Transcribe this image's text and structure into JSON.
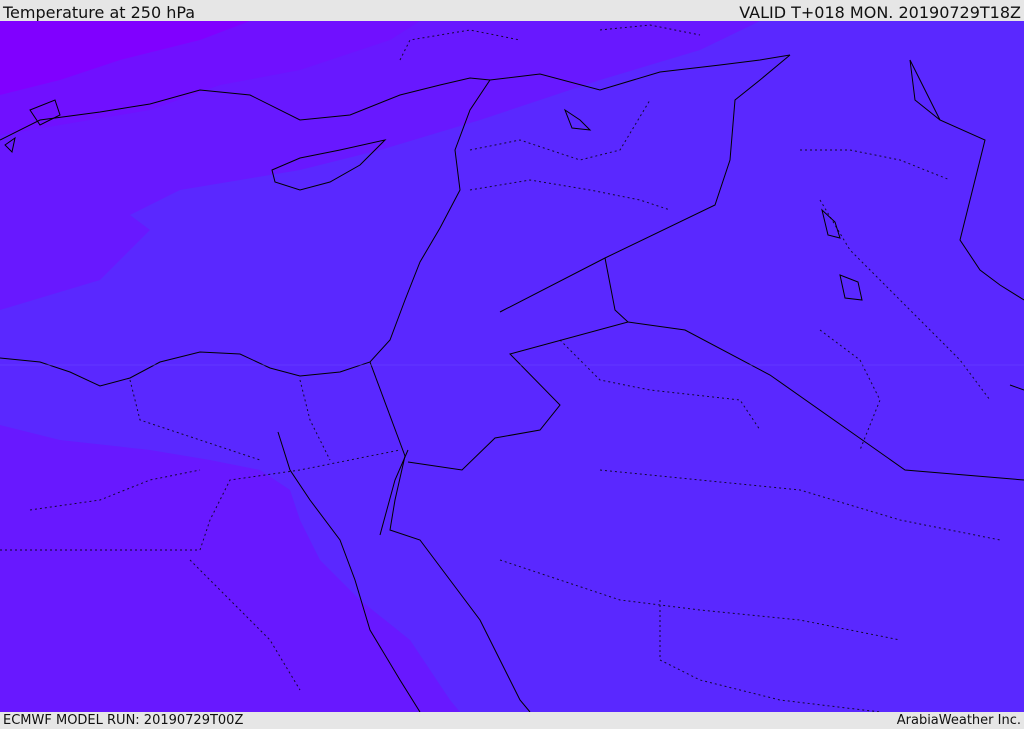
{
  "header": {
    "title": "Temperature at 250 hPa",
    "valid": "VALID T+018 MON. 20190729T18Z"
  },
  "footer": {
    "model_run": "ECMWF MODEL RUN: 20190729T00Z",
    "credit": "ArabiaWeather Inc."
  },
  "colors": {
    "band_cold": "#8000ff",
    "band_2": "#7010ff",
    "band_3": "#6818ff",
    "band_4": "#5a28ff",
    "coastline": "#000000",
    "border": "#000000",
    "frame_bg": "#e6e6e6"
  }
}
